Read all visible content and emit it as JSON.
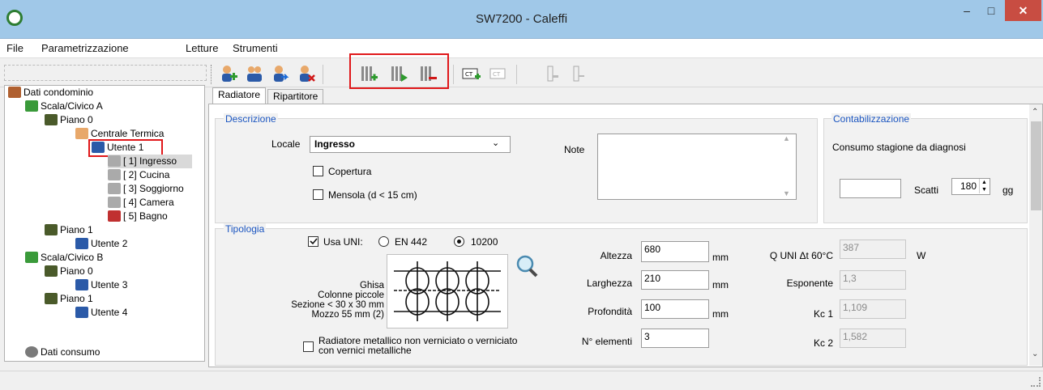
{
  "window": {
    "title": "SW7200 - Caleffi",
    "minimize": "–",
    "maximize": "□",
    "close": "✕"
  },
  "menu": [
    "File",
    "Parametrizzazione",
    "Letture",
    "Strumenti"
  ],
  "tree": {
    "root": "Dati condominio",
    "scala_a": "Scala/Civico A",
    "piano0_a": "Piano  0",
    "centrale": "Centrale Termica",
    "utente1": "Utente 1",
    "rooms": [
      "[ 1] Ingresso",
      "[ 2] Cucina",
      "[ 3] Soggiorno",
      "[ 4] Camera",
      "[ 5] Bagno"
    ],
    "piano1_a": "Piano  1",
    "utente2": "Utente 2",
    "scala_b": "Scala/Civico B",
    "piano0_b": "Piano  0",
    "utente3": "Utente 3",
    "piano1_b": "Piano  1",
    "utente4": "Utente 4",
    "consumo": "Dati consumo"
  },
  "tabs": [
    "Radiatore",
    "Ripartitore"
  ],
  "descrizione": {
    "title": "Descrizione",
    "locale_label": "Locale",
    "locale_value": "Ingresso",
    "copertura": "Copertura",
    "mensola": "Mensola (d < 15 cm)",
    "note_label": "Note"
  },
  "contabilizzazione": {
    "title": "Contabilizzazione",
    "consumo": "Consumo stagione da diagnosi",
    "scatti": "Scatti",
    "scatti_value": "180",
    "gg": "gg"
  },
  "tipologia": {
    "title": "Tipologia",
    "usa_uni": "Usa UNI:",
    "opt1": "EN 442",
    "opt2": "10200",
    "desc1": "Ghisa",
    "desc2": "Colonne piccole",
    "desc3": "Sezione < 30 x 30 mm",
    "desc4": "Mozzo 55 mm (2)",
    "metallico1": "Radiatore metallico non verniciato o verniciato",
    "metallico2": "con vernici metalliche",
    "altezza": "Altezza",
    "altezza_v": "680",
    "larghezza": "Larghezza",
    "larghezza_v": "210",
    "profondita": "Profondità",
    "profondita_v": "100",
    "elementi": "N° elementi",
    "elementi_v": "3",
    "mm": "mm",
    "quni": "Q UNI Δt 60°C",
    "quni_v": "387",
    "w": "W",
    "esponente": "Esponente",
    "esponente_v": "1,3",
    "kc1": "Kc 1",
    "kc1_v": "1,109",
    "kc2": "Kc 2",
    "kc2_v": "1,582"
  },
  "colors": {
    "titlebar": "#a0c8e8",
    "highlight": "#e0181a",
    "group_title": "#1b55c0"
  }
}
